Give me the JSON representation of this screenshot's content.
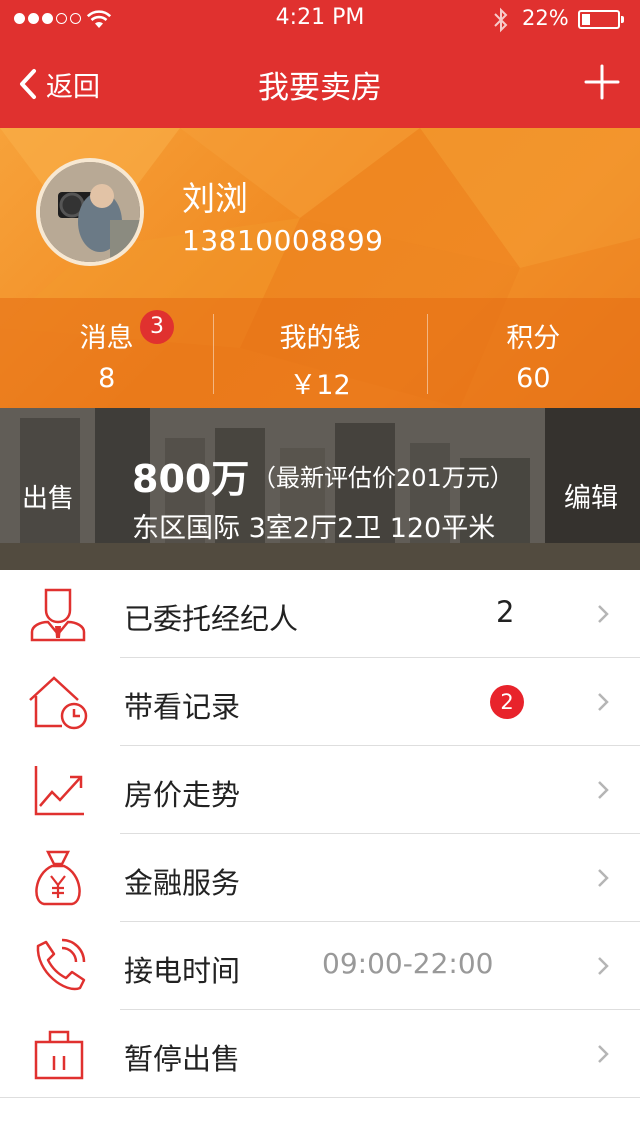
{
  "status_bar": {
    "time": "4:21 PM",
    "battery": "22%",
    "signal_bars_filled": 3,
    "signal_bars_total": 5
  },
  "nav": {
    "back_label": "返回",
    "title": "我要卖房",
    "add_icon": "plus-icon"
  },
  "profile": {
    "name": "刘浏",
    "phone": "13810008899"
  },
  "stats": [
    {
      "label": "消息",
      "value": "8",
      "badge": "3"
    },
    {
      "label": "我的钱",
      "value": "￥12"
    },
    {
      "label": "积分",
      "value": "60"
    }
  ],
  "property": {
    "tag": "出售",
    "price": "800万",
    "estimate": "（最新评估价201万元）",
    "description": "东区国际 3室2厅2卫 120平米",
    "edit_label": "编辑"
  },
  "menu": [
    {
      "label": "已委托经纪人",
      "value": "2",
      "icon": "agent-icon"
    },
    {
      "label": "带看记录",
      "badge": "2",
      "icon": "house-clock-icon"
    },
    {
      "label": "房价走势",
      "icon": "trend-chart-icon"
    },
    {
      "label": "金融服务",
      "icon": "money-bag-icon"
    },
    {
      "label": "接电时间",
      "value": "09:00-22:00",
      "icon": "phone-icon"
    },
    {
      "label": "暂停出售",
      "icon": "briefcase-icon"
    }
  ],
  "colors": {
    "brand_red": "#e0312f",
    "header_orange": "#f08a22",
    "badge_red": "#e8232b",
    "muted_text": "#999999"
  }
}
